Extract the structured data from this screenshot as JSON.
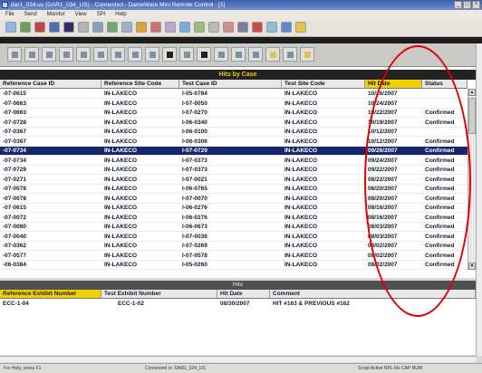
{
  "window": {
    "title": "dar1_034.us (DAR1_034_US) - Connected - DameWare Mini Remote Control - [1]",
    "controls": [
      "_",
      "□",
      "×"
    ]
  },
  "menu": [
    "File",
    "Send",
    "Monitor",
    "View",
    "SPI",
    "Help"
  ],
  "app": {
    "table_caption": "Hits by Case",
    "columns": [
      "Reference Case ID",
      "Reference Site Code",
      "Test Case ID",
      "Test Site Code",
      "Hit Date",
      "Status"
    ],
    "rows": [
      [
        "-07-0615",
        "IN-LAKECO",
        "I-05-0784",
        "IN-LAKECO",
        "10/26/2007",
        ""
      ],
      [
        "-07-0663",
        "IN-LAKECO",
        "I-07-0050",
        "IN-LAKECO",
        "10/24/2007",
        ""
      ],
      [
        "-07-0663",
        "IN-LAKECO",
        "I-07-0270",
        "IN-LAKECO",
        "10/22/2007",
        "Confirmed"
      ],
      [
        "-07-0728",
        "IN-LAKECO",
        "I-06-0340",
        "IN-LAKECO",
        "10/19/2007",
        "Confirmed"
      ],
      [
        "-07-0367",
        "IN-LAKECO",
        "I-06-0100",
        "IN-LAKECO",
        "10/12/2007",
        ""
      ],
      [
        "-07-0367",
        "IN-LAKECO",
        "I-06-0306",
        "IN-LAKECO",
        "10/12/2007",
        "Confirmed"
      ],
      [
        "-07-0734",
        "IN-LAKECO",
        "I-07-0729",
        "IN-LAKECO",
        "09/26/2007",
        "Confirmed"
      ],
      [
        "-07-0734",
        "IN-LAKECO",
        "I-07-0373",
        "IN-LAKECO",
        "09/24/2007",
        "Confirmed"
      ],
      [
        "-07-0729",
        "IN-LAKECO",
        "I-07-0373",
        "IN-LAKECO",
        "09/22/2007",
        "Confirmed"
      ],
      [
        "-07-0271",
        "IN-LAKECO",
        "I-07-0021",
        "IN-LAKECO",
        "08/22/2007",
        "Confirmed"
      ],
      [
        "-07-0078",
        "IN-LAKECO",
        "I-06-0765",
        "IN-LAKECO",
        "08/20/2007",
        "Confirmed"
      ],
      [
        "-07-0078",
        "IN-LAKECO",
        "I-07-0070",
        "IN-LAKECO",
        "08/20/2007",
        "Confirmed"
      ],
      [
        "-07-0615",
        "IN-LAKECO",
        "I-06-0276",
        "IN-LAKECO",
        "08/16/2007",
        "Confirmed"
      ],
      [
        "-07-0072",
        "IN-LAKECO",
        "I-06-0276",
        "IN-LAKECO",
        "08/16/2007",
        "Confirmed"
      ],
      [
        "-07-0080",
        "IN-LAKECO",
        "I-06-0673",
        "IN-LAKECO",
        "08/03/2007",
        "Confirmed"
      ],
      [
        "-07-0040",
        "IN-LAKECO",
        "I-07-0036",
        "IN-LAKECO",
        "08/03/2007",
        "Confirmed"
      ],
      [
        "-07-0362",
        "IN-LAKECO",
        "I-07-0269",
        "IN-LAKECO",
        "08/02/2007",
        "Confirmed"
      ],
      [
        "-07-0577",
        "IN-LAKECO",
        "I-07-0578",
        "IN-LAKECO",
        "08/02/2007",
        "Confirmed"
      ],
      [
        "-06-0384",
        "IN-LAKECO",
        "I-05-0260",
        "IN-LAKECO",
        "08/02/2007",
        "Confirmed"
      ]
    ],
    "selected_row": 6,
    "hits_caption": "Hits",
    "hits_columns": [
      "Reference Exhibit Number",
      "Test Exhibit Number",
      "Hit Date",
      "Comment"
    ],
    "hits_rows": [
      [
        "ECC-1-04",
        "ECC-1-02",
        "08/30/2007",
        "HIT #163 & PREVIOUS #162"
      ]
    ]
  },
  "status": {
    "left": "For Help, press F1",
    "middle": "Connected to: DAR1_034_US",
    "right": "Script Active   NPL-No   CAP   NUM"
  },
  "colors": {
    "selected_row": "#16286b",
    "sorted_header": "#f0d000",
    "annotation": "#e00000"
  }
}
